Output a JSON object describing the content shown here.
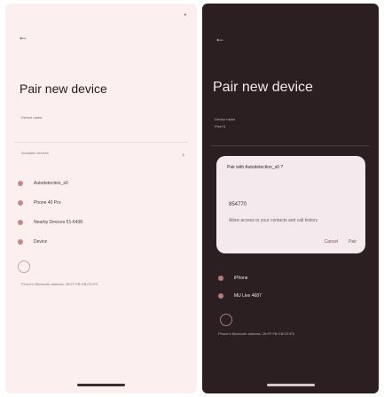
{
  "left": {
    "status_time": "",
    "status_sys": "•",
    "title": "Pair new device",
    "device_name_label": "Device name",
    "device_name_value": "",
    "available_label": "Available devices",
    "items": [
      {
        "label": "Autodetection_s0",
        "icon": "headphones-icon"
      },
      {
        "label": "Phone 40 Pro",
        "icon": "phone-icon"
      },
      {
        "label": "Nearby Devices 51-6408",
        "icon": "bluetooth-icon"
      },
      {
        "label": "Device",
        "icon": "phone-icon"
      }
    ],
    "footer": "Phone's Bluetooth address: 28:FF:FB:CB:CE:E0"
  },
  "right": {
    "title": "Pair new device",
    "device_name_label": "Device name",
    "device_name_value": "Pixel 5",
    "dialog": {
      "question": "Pair with Autodetection_s0 ?",
      "code": "854770",
      "checkbox": "Allow access to your contacts and call history",
      "cancel": "Cancel",
      "pair": "Pair"
    },
    "items": [
      {
        "label": "iPhone",
        "icon": "phone-icon"
      },
      {
        "label": "MU Live 4687",
        "icon": "bluetooth-icon"
      }
    ],
    "footer": "Phone's Bluetooth address: 28:FF:FB:CB:CE:E0"
  }
}
